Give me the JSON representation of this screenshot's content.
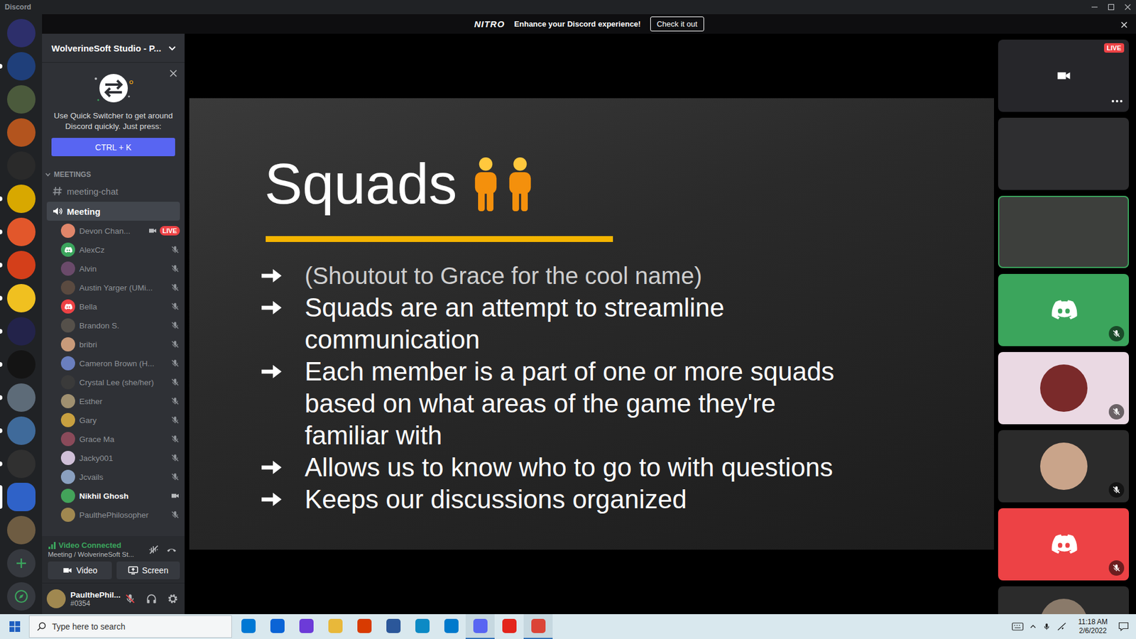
{
  "window": {
    "title": "Discord"
  },
  "banner": {
    "logo": "NITRO",
    "text": "Enhance your Discord experience!",
    "button": "Check it out"
  },
  "servers": [
    {
      "color": "#2d2f6b",
      "unread": false,
      "selected": false
    },
    {
      "color": "#1f3f7a",
      "unread": true,
      "selected": false
    },
    {
      "color": "#4b5a3c",
      "unread": false,
      "selected": false
    },
    {
      "color": "#b3541e",
      "unread": false,
      "selected": false
    },
    {
      "color": "#2a2a2a",
      "unread": false,
      "selected": false
    },
    {
      "color": "#d8a800",
      "unread": true,
      "selected": false
    },
    {
      "color": "#e2572b",
      "unread": true,
      "selected": false
    },
    {
      "color": "#d43f1a",
      "unread": true,
      "selected": false
    },
    {
      "color": "#f0c020",
      "unread": true,
      "selected": false
    },
    {
      "color": "#23234a",
      "unread": true,
      "selected": false
    },
    {
      "color": "#141414",
      "unread": true,
      "selected": false
    },
    {
      "color": "#5d6b78",
      "unread": true,
      "selected": false
    },
    {
      "color": "#3f6a9a",
      "unread": true,
      "selected": false
    },
    {
      "color": "#303030",
      "unread": true,
      "selected": false
    },
    {
      "color": "#2f62c8",
      "unread": false,
      "selected": true
    },
    {
      "color": "#6e5c42",
      "unread": false,
      "selected": false
    }
  ],
  "server_name": "WolverineSoft Studio - P...",
  "quick_switcher": {
    "text": "Use Quick Switcher to get around Discord quickly. Just press:",
    "button": "CTRL + K"
  },
  "category": {
    "name": "MEETINGS",
    "expanded": true
  },
  "channels": [
    {
      "name": "meeting-chat",
      "kind": "text",
      "selected": false
    },
    {
      "name": "Meeting",
      "kind": "voice",
      "selected": true
    }
  ],
  "voice_users": [
    {
      "name": "Devon Chan...",
      "kind": "photo",
      "color": "#e0866a",
      "video": true,
      "badge": "LIVE",
      "muted": false,
      "speaking": false
    },
    {
      "name": "AlexCz",
      "kind": "default",
      "color": "#3ba55d",
      "video": false,
      "muted": true,
      "speaking": false
    },
    {
      "name": "Alvin",
      "kind": "photo",
      "color": "#6a4a6a",
      "video": false,
      "muted": true,
      "speaking": false
    },
    {
      "name": "Austin Yarger (UMi...",
      "kind": "photo",
      "color": "#5a4a40",
      "video": false,
      "muted": true,
      "speaking": false
    },
    {
      "name": "Bella",
      "kind": "default",
      "color": "#ed4245",
      "video": false,
      "muted": true,
      "speaking": false
    },
    {
      "name": "Brandon S.",
      "kind": "photo",
      "color": "#55504a",
      "video": false,
      "muted": true,
      "speaking": false
    },
    {
      "name": "bribri",
      "kind": "photo",
      "color": "#c89a7a",
      "video": false,
      "muted": true,
      "speaking": false
    },
    {
      "name": "Cameron Brown (H...",
      "kind": "photo",
      "color": "#6a7fbf",
      "video": false,
      "muted": true,
      "speaking": false
    },
    {
      "name": "Crystal Lee (she/her)",
      "kind": "photo",
      "color": "#3a3a3a",
      "video": false,
      "muted": true,
      "speaking": false
    },
    {
      "name": "Esther",
      "kind": "photo",
      "color": "#a09070",
      "video": false,
      "muted": true,
      "speaking": false
    },
    {
      "name": "Gary",
      "kind": "photo",
      "color": "#c8a040",
      "video": false,
      "muted": true,
      "speaking": false
    },
    {
      "name": "Grace Ma",
      "kind": "photo",
      "color": "#8a4a5a",
      "video": false,
      "muted": true,
      "speaking": false
    },
    {
      "name": "Jacky001",
      "kind": "photo",
      "color": "#d0c0d8",
      "video": false,
      "muted": true,
      "speaking": false
    },
    {
      "name": "Jcvails",
      "kind": "photo",
      "color": "#8aa0c0",
      "video": false,
      "muted": true,
      "speaking": false
    },
    {
      "name": "Nikhil Ghosh",
      "kind": "photo",
      "color": "#43a35a",
      "video": true,
      "muted": false,
      "speaking": true
    },
    {
      "name": "PaulthePhilosopher",
      "kind": "photo",
      "color": "#a08850",
      "video": false,
      "muted": true,
      "speaking": false
    }
  ],
  "voice_panel": {
    "status": "Video Connected",
    "location": "Meeting / WolverineSoft St...",
    "buttons": [
      {
        "label": "Video",
        "kind": "video"
      },
      {
        "label": "Screen",
        "kind": "screen"
      }
    ]
  },
  "user": {
    "name": "PaulthePhil...",
    "tag": "#0354",
    "muted": true,
    "color": "#a08850"
  },
  "slide": {
    "title": "Squads",
    "bullets": [
      {
        "text": "(Shoutout to Grace for the cool name)",
        "dim": true
      },
      {
        "text": "Squads are an attempt to streamline communication",
        "dim": false
      },
      {
        "text": "Each member is a part of one or more squads based on what areas of the game they're familiar with",
        "dim": false
      },
      {
        "text": "Allows us to know who to go to with questions",
        "dim": false
      },
      {
        "text": "Keeps our discussions organized",
        "dim": false
      }
    ]
  },
  "tiles": [
    {
      "kind": "stream",
      "color": "#26262a",
      "badge": "LIVE",
      "muted": false,
      "selected": false
    },
    {
      "kind": "screen",
      "color": "#2e2e30",
      "muted": false,
      "selected": false
    },
    {
      "kind": "video",
      "color": "#3d3f3c",
      "muted": false,
      "selected": true
    },
    {
      "kind": "default",
      "color": "#3ba55c",
      "muted": true,
      "selected": false
    },
    {
      "kind": "photo",
      "color": "#ead9e3",
      "avatar": "#7a2a2a",
      "muted": true,
      "selected": false
    },
    {
      "kind": "photo",
      "color": "#2b2b2b",
      "avatar": "#c9a48a",
      "muted": true,
      "selected": false
    },
    {
      "kind": "default",
      "color": "#ed4245",
      "muted": true,
      "selected": false
    },
    {
      "kind": "photo",
      "color": "#2b2b2b",
      "avatar": "#8a7a6a",
      "muted": false,
      "selected": false
    }
  ],
  "taskbar": {
    "search_placeholder": "Type here to search",
    "apps": [
      {
        "color": "#0078d4",
        "active": false
      },
      {
        "color": "#0a64d6",
        "active": false
      },
      {
        "color": "#6c3bd8",
        "active": false
      },
      {
        "color": "#e8b83a",
        "active": false
      },
      {
        "color": "#d83b01",
        "active": false
      },
      {
        "color": "#2b579a",
        "active": false
      },
      {
        "color": "#0c8ac5",
        "active": false
      },
      {
        "color": "#007acc",
        "active": false
      },
      {
        "color": "#5865f2",
        "active": true
      },
      {
        "color": "#e3241b",
        "active": false
      },
      {
        "color": "#db4437",
        "active": true
      }
    ],
    "time": "11:18 AM",
    "date": "2/6/2022"
  }
}
